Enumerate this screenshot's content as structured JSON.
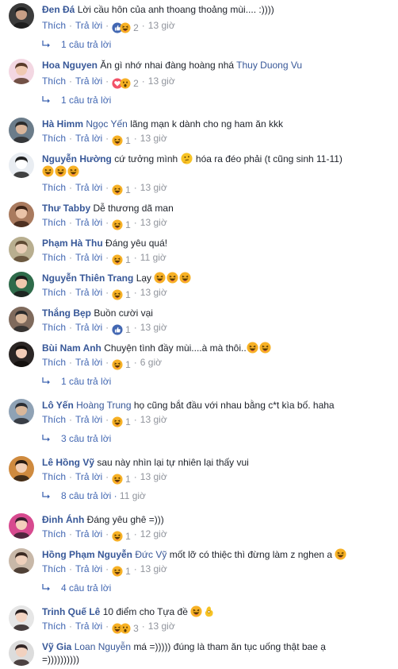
{
  "labels": {
    "like": "Thích",
    "reply": "Trả lời"
  },
  "colors": {
    "link": "#4267b2",
    "author": "#385898",
    "meta": "#90949c",
    "like_blue": "#4267b2",
    "love_red": "#f25268",
    "haha_yellow": "#f7b125"
  },
  "comments": [
    {
      "author": "Đen Đá",
      "tag": "",
      "text_lines": [
        "Lời cầu hôn của anh thoang thoảng mùi.... :))))"
      ],
      "emoji_after": [],
      "reactions": [
        "like",
        "haha"
      ],
      "count": "2",
      "time": "13 giờ",
      "replies": "1 câu trả lời",
      "replies_time": "",
      "avatar": "avatar-man-dark"
    },
    {
      "author": "Hoa Nguyen",
      "tag": "",
      "text_lines": [
        "Ăn gì nhớ nhai đàng hoàng nhá "
      ],
      "tag_after": "Thuy Duong Vu",
      "emoji_after": [],
      "reactions": [
        "love",
        "wow"
      ],
      "count": "2",
      "time": "13 giờ",
      "replies": "1 câu trả lời",
      "replies_time": "",
      "avatar": "avatar-girl-pink"
    },
    {
      "author": "Hà Himm",
      "tag": "Ngọc Yến",
      "text_lines": [
        "lãng mạn k dành cho ng ham ăn kkk"
      ],
      "emoji_after": [],
      "reactions": [
        "haha"
      ],
      "count": "1",
      "time": "13 giờ",
      "replies": "",
      "replies_time": "",
      "avatar": "avatar-outdoor"
    },
    {
      "author": "Nguyễn Hường",
      "tag": "",
      "text_lines": [
        "cứ tưởng mình",
        "hóa ra đéo phải (t cũng sinh 11-11)"
      ],
      "emoji_mid": "thinking",
      "emoji_after": [
        "haha",
        "haha",
        "haha"
      ],
      "reactions": [
        "haha"
      ],
      "count": "1",
      "time": "13 giờ",
      "replies": "",
      "replies_time": "",
      "avatar": "avatar-panda"
    },
    {
      "author": "Thư Tabby",
      "tag": "",
      "text_lines": [
        "Dễ thương dã man"
      ],
      "emoji_after": [],
      "reactions": [
        "haha"
      ],
      "count": "1",
      "time": "13 giờ",
      "replies": "",
      "replies_time": "",
      "avatar": "avatar-girl-brown"
    },
    {
      "author": "Phạm Hà Thu",
      "tag": "",
      "text_lines": [
        "Đáng yêu quá!"
      ],
      "emoji_after": [],
      "reactions": [
        "haha"
      ],
      "count": "1",
      "time": "11 giờ",
      "replies": "",
      "replies_time": "",
      "avatar": "avatar-girl-light"
    },
    {
      "author": "Nguyễn Thiên Trang",
      "tag": "",
      "text_lines": [
        "Lạy "
      ],
      "emoji_after": [
        "haha",
        "haha",
        "haha"
      ],
      "reactions": [
        "haha"
      ],
      "count": "1",
      "time": "13 giờ",
      "replies": "",
      "replies_time": "",
      "avatar": "avatar-girl-green"
    },
    {
      "author": "Thắng Bẹp",
      "tag": "",
      "text_lines": [
        "Buồn cười vại"
      ],
      "emoji_after": [],
      "reactions": [
        "like"
      ],
      "count": "1",
      "time": "13 giờ",
      "replies": "",
      "replies_time": "",
      "avatar": "avatar-group"
    },
    {
      "author": "Bùi Nam Anh",
      "tag": "",
      "text_lines": [
        "Chuyện tình đầy mùi....à mà thôi.."
      ],
      "emoji_after": [
        "haha",
        "haha"
      ],
      "reactions": [
        "haha"
      ],
      "count": "1",
      "time": "6 giờ",
      "replies": "1 câu trả lời",
      "replies_time": "",
      "avatar": "avatar-girl-dark"
    },
    {
      "author": "Lô Yến",
      "tag": "Hoàng Trung",
      "text_lines": [
        "họ cũng bắt đầu với nhau bằng c*t kìa bố. haha"
      ],
      "emoji_after": [],
      "reactions": [
        "haha"
      ],
      "count": "1",
      "time": "13 giờ",
      "replies": "3 câu trả lời",
      "replies_time": "",
      "avatar": "avatar-bike"
    },
    {
      "author": "Lê Hồng Vỹ",
      "tag": "",
      "text_lines": [
        "sau này nhìn lại tự nhiên lại thấy vui"
      ],
      "emoji_after": [],
      "reactions": [
        "haha"
      ],
      "count": "1",
      "time": "13 giờ",
      "replies": "8 câu trả lời",
      "replies_time": "11 giờ",
      "avatar": "avatar-couple"
    },
    {
      "author": "Đinh Ánh",
      "tag": "",
      "text_lines": [
        "Đáng yêu ghê =)))"
      ],
      "emoji_after": [],
      "reactions": [
        "haha"
      ],
      "count": "1",
      "time": "12 giờ",
      "replies": "",
      "replies_time": "",
      "avatar": "avatar-girl-pink2"
    },
    {
      "author": "Hồng Phạm Nguyễn",
      "tag": "Đức Vỹ",
      "text_lines": [
        "mốt lỡ có thiệc thì đừng làm z nghen a "
      ],
      "emoji_after": [
        "haha"
      ],
      "reactions": [
        "haha"
      ],
      "count": "1",
      "time": "13 giờ",
      "replies": "4 câu trả lời",
      "replies_time": "",
      "avatar": "avatar-couple2"
    },
    {
      "author": "Trinh Quế Lê",
      "tag": "",
      "text_lines": [
        "10 điểm cho Tựa đề "
      ],
      "emoji_after": [
        "haha",
        "ok"
      ],
      "reactions": [
        "haha",
        "wow"
      ],
      "count": "3",
      "time": "13 giờ",
      "replies": "",
      "replies_time": "",
      "avatar": "avatar-girl-white"
    },
    {
      "author": "Vỹ Gia",
      "tag": "Loan Nguyễn",
      "text_lines": [
        "má =))))) đúng là tham ăn tục uống thật bae ạ",
        "=))))))))))"
      ],
      "emoji_after": [],
      "reactions": [],
      "count": "",
      "time": "",
      "replies": "",
      "replies_time": "",
      "avatar": "avatar-girl-white2"
    }
  ]
}
